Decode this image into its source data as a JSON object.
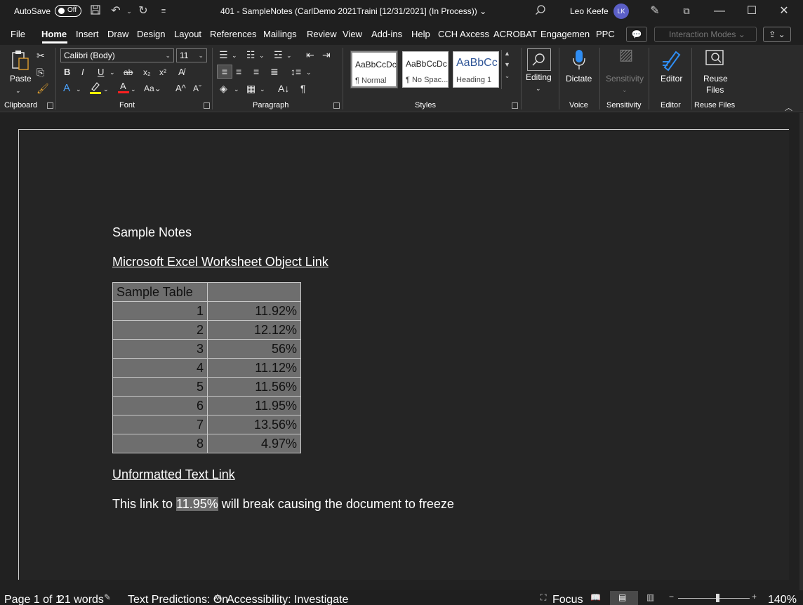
{
  "titlebar": {
    "autosave_label": "AutoSave",
    "autosave_state": "Off",
    "doc_title": "401 - SampleNotes (CarlDemo 2021Traini [12/31/2021] (In Process))",
    "user_name": "Leo Keefe",
    "user_initials": "LK"
  },
  "tabs": [
    "File",
    "Home",
    "Insert",
    "Draw",
    "Design",
    "Layout",
    "References",
    "Mailings",
    "Review",
    "View",
    "Add-ins",
    "Help",
    "CCH Axcess",
    "ACROBAT",
    "Engagemen",
    "PPC"
  ],
  "active_tab": "Home",
  "interaction_modes": "Interaction Modes",
  "ribbon": {
    "paste_label": "Paste",
    "font_name": "Calibri (Body)",
    "font_size": "11",
    "styles": [
      {
        "sample": "AaBbCcDc",
        "name": "¶ Normal"
      },
      {
        "sample": "AaBbCcDc",
        "name": "¶ No Spac..."
      },
      {
        "sample": "AaBbCc",
        "name": "Heading 1"
      }
    ],
    "editing_label": "Editing",
    "dictate_label": "Dictate",
    "sensitivity_label": "Sensitivity",
    "editor_label": "Editor",
    "reuse_label_1": "Reuse",
    "reuse_label_2": "Files",
    "groups": {
      "clipboard": "Clipboard",
      "font": "Font",
      "paragraph": "Paragraph",
      "styles": "Styles",
      "voice": "Voice",
      "sensitivity": "Sensitivity",
      "editor": "Editor",
      "reuse_files": "Reuse Files"
    }
  },
  "document": {
    "title": "Sample Notes",
    "heading_excel": "Microsoft Excel Worksheet Object Link",
    "table_header": [
      "Sample Table",
      ""
    ],
    "table_rows": [
      [
        "1",
        "11.92%"
      ],
      [
        "2",
        "12.12%"
      ],
      [
        "3",
        "56%"
      ],
      [
        "4",
        "11.12%"
      ],
      [
        "5",
        "11.56%"
      ],
      [
        "6",
        "11.95%"
      ],
      [
        "7",
        "13.56%"
      ],
      [
        "8",
        "4.97%"
      ]
    ],
    "heading_text_link": "Unformatted Text Link",
    "para_before": "This link to ",
    "para_field": "11.95%",
    "para_after": " will break causing the document to freeze"
  },
  "statusbar": {
    "page": "Page 1 of 1",
    "words": "21 words",
    "text_predictions": "Text Predictions: On",
    "accessibility": "Accessibility: Investigate",
    "focus": "Focus",
    "zoom": "140%"
  }
}
